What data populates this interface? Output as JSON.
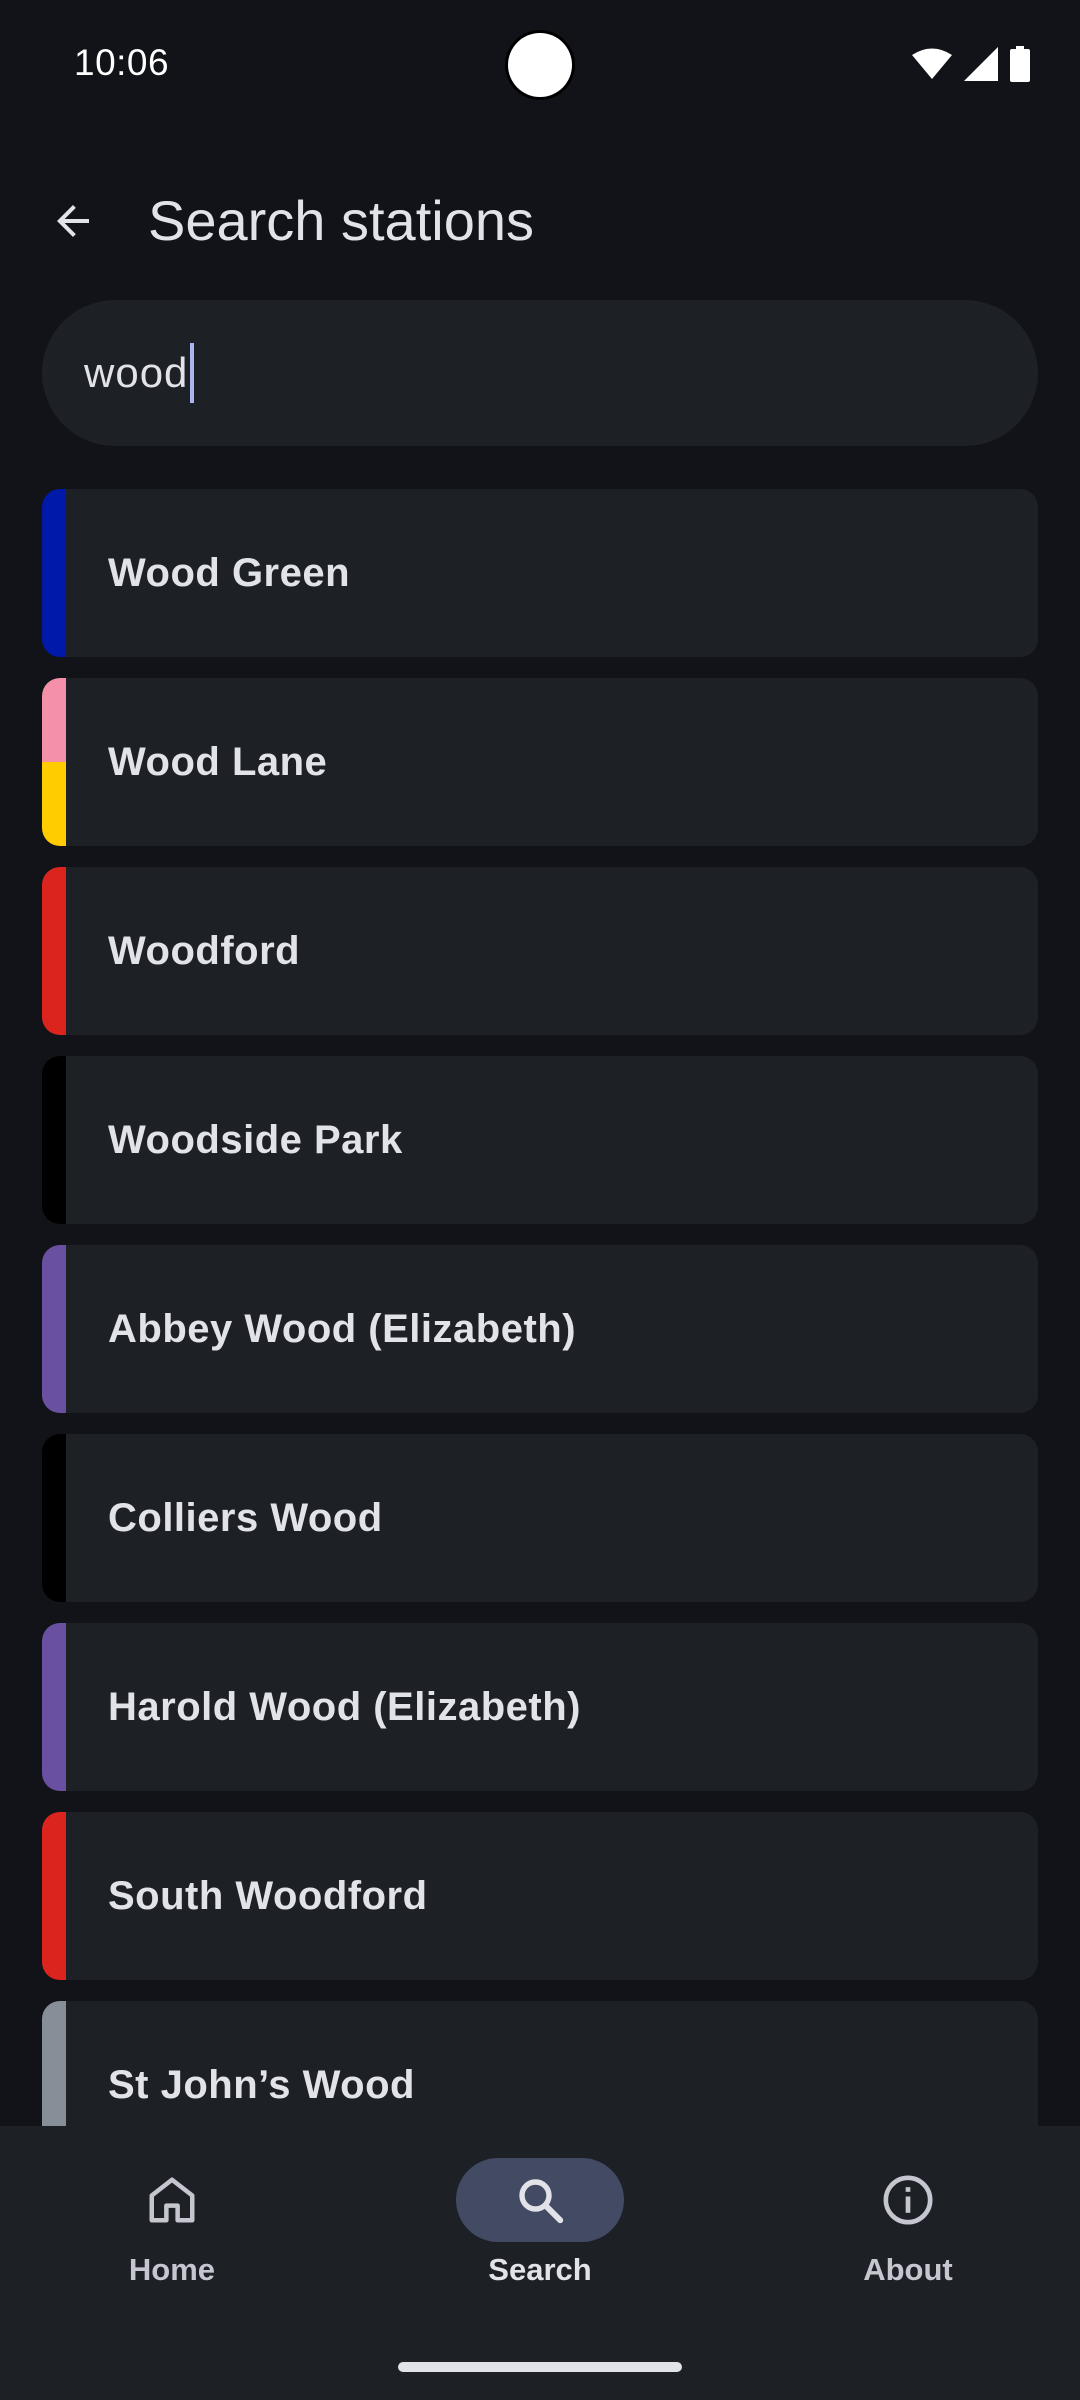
{
  "status_bar": {
    "time": "10:06"
  },
  "app_bar": {
    "title": "Search stations",
    "back_icon": "arrow-back-icon"
  },
  "search": {
    "value": "wood"
  },
  "results": [
    {
      "name": "Wood Green",
      "line_colors": [
        "#0019a8"
      ]
    },
    {
      "name": "Wood Lane",
      "line_colors": [
        "#f491a8",
        "#ffcc00"
      ]
    },
    {
      "name": "Woodford",
      "line_colors": [
        "#dc241f"
      ]
    },
    {
      "name": "Woodside Park",
      "line_colors": [
        "#000000"
      ]
    },
    {
      "name": "Abbey Wood (Elizabeth)",
      "line_colors": [
        "#6950a1"
      ]
    },
    {
      "name": "Colliers Wood",
      "line_colors": [
        "#000000"
      ]
    },
    {
      "name": "Harold Wood (Elizabeth)",
      "line_colors": [
        "#6950a1"
      ]
    },
    {
      "name": "South Woodford",
      "line_colors": [
        "#dc241f"
      ]
    },
    {
      "name": "St John’s Wood",
      "line_colors": [
        "#868f98"
      ]
    }
  ],
  "bottom_nav": {
    "items": [
      {
        "label": "Home",
        "icon": "home-icon",
        "active": false
      },
      {
        "label": "Search",
        "icon": "search-icon",
        "active": true
      },
      {
        "label": "About",
        "icon": "info-icon",
        "active": false
      }
    ]
  },
  "colors": {
    "background": "#111318",
    "surface": "#1d2025",
    "active_indicator": "#434a63",
    "caret": "#a9b6f2"
  }
}
